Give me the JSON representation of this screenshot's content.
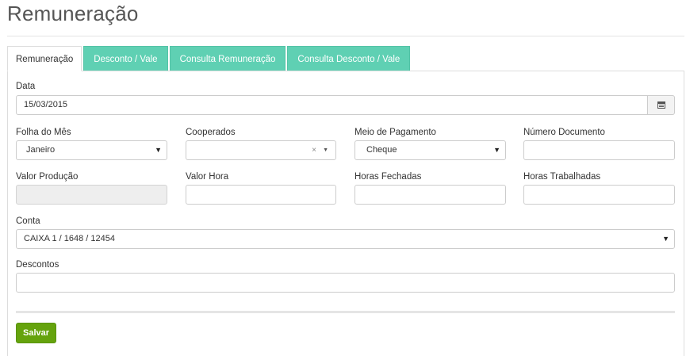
{
  "page": {
    "title": "Remuneração"
  },
  "tabs": [
    {
      "label": "Remuneração",
      "active": true
    },
    {
      "label": "Desconto / Vale",
      "active": false
    },
    {
      "label": "Consulta Remuneração",
      "active": false
    },
    {
      "label": "Consulta Desconto / Vale",
      "active": false
    }
  ],
  "form": {
    "data": {
      "label": "Data",
      "value": "15/03/2015",
      "icon": "calendar-icon"
    },
    "folha_mes": {
      "label": "Folha do Mês",
      "value": "Janeiro"
    },
    "cooperados": {
      "label": "Cooperados",
      "value": "",
      "clear_glyph": "×"
    },
    "meio_pagamento": {
      "label": "Meio de Pagamento",
      "value": "Cheque"
    },
    "numero_documento": {
      "label": "Número Documento",
      "value": ""
    },
    "valor_producao": {
      "label": "Valor Produção",
      "value": "",
      "disabled": true
    },
    "valor_hora": {
      "label": "Valor Hora",
      "value": ""
    },
    "horas_fechadas": {
      "label": "Horas Fechadas",
      "value": ""
    },
    "horas_trabalhadas": {
      "label": "Horas Trabalhadas",
      "value": ""
    },
    "conta": {
      "label": "Conta",
      "value": "CAIXA 1 / 1648 / 12454"
    },
    "descontos": {
      "label": "Descontos",
      "value": ""
    }
  },
  "actions": {
    "save_label": "Salvar"
  },
  "colors": {
    "tab_inactive": "#5fd0b3",
    "save_button": "#65a30d"
  }
}
